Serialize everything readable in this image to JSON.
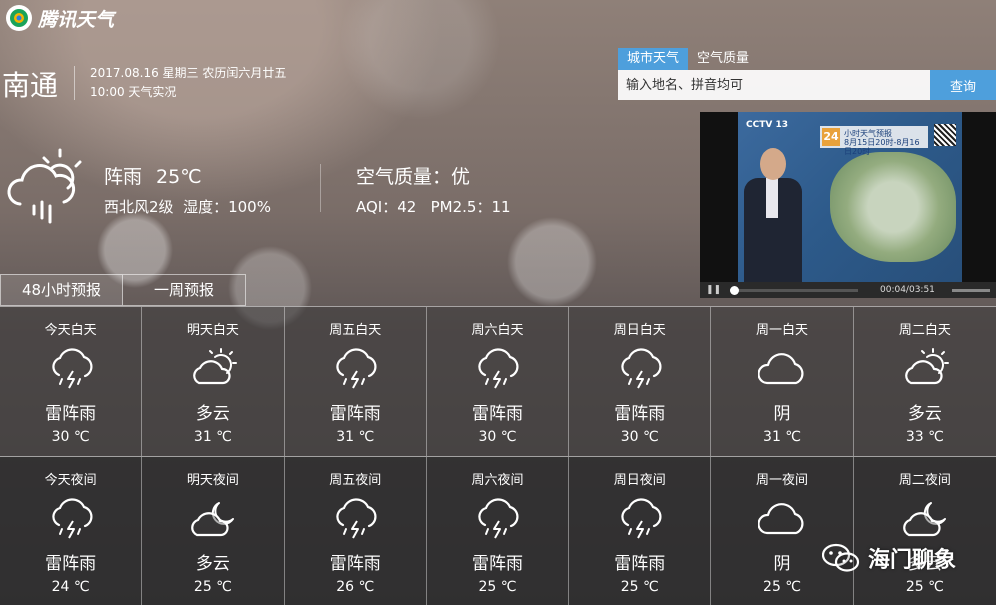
{
  "brand": {
    "name": "腾讯天气"
  },
  "location": {
    "city": "南通"
  },
  "observation": {
    "date_line": "2017.08.16 星期三 农历闰六月廿五",
    "time_line": "10:00 天气实况"
  },
  "search": {
    "tabs": [
      "城市天气",
      "空气质量"
    ],
    "active_tab": 0,
    "placeholder": "输入地名、拼音均可",
    "button": "查询"
  },
  "current": {
    "icon": "rain-cloud-sun-icon",
    "condition": "阵雨",
    "temperature": "25℃",
    "wind": "西北风2级",
    "humidity": "湿度：100%"
  },
  "air": {
    "title": "空气质量：优",
    "aqi_line": "AQI：42   PM2.5：11"
  },
  "video": {
    "logo": "CCTV 13",
    "banner_num": "24",
    "banner_title": "小时天气预报",
    "banner_sub": "8月15日20时-8月16日20时",
    "time": "00:04/03:51"
  },
  "forecast_tabs": [
    "48小时预报",
    "一周预报"
  ],
  "active_forecast_tab": 0,
  "day_forecast": [
    {
      "label": "今天白天",
      "icon": "thunder-rain-icon",
      "condition": "雷阵雨",
      "temp": "30 ℃"
    },
    {
      "label": "明天白天",
      "icon": "cloudy-sun-icon",
      "condition": "多云",
      "temp": "31 ℃"
    },
    {
      "label": "周五白天",
      "icon": "thunder-rain-icon",
      "condition": "雷阵雨",
      "temp": "31 ℃"
    },
    {
      "label": "周六白天",
      "icon": "thunder-rain-icon",
      "condition": "雷阵雨",
      "temp": "30 ℃"
    },
    {
      "label": "周日白天",
      "icon": "thunder-rain-icon",
      "condition": "雷阵雨",
      "temp": "30 ℃"
    },
    {
      "label": "周一白天",
      "icon": "overcast-icon",
      "condition": "阴",
      "temp": "31 ℃"
    },
    {
      "label": "周二白天",
      "icon": "cloudy-sun-icon",
      "condition": "多云",
      "temp": "33 ℃"
    }
  ],
  "night_forecast": [
    {
      "label": "今天夜间",
      "icon": "thunder-rain-icon",
      "condition": "雷阵雨",
      "temp": "24 ℃"
    },
    {
      "label": "明天夜间",
      "icon": "cloudy-moon-icon",
      "condition": "多云",
      "temp": "25 ℃"
    },
    {
      "label": "周五夜间",
      "icon": "thunder-rain-icon",
      "condition": "雷阵雨",
      "temp": "26 ℃"
    },
    {
      "label": "周六夜间",
      "icon": "thunder-rain-icon",
      "condition": "雷阵雨",
      "temp": "25 ℃"
    },
    {
      "label": "周日夜间",
      "icon": "thunder-rain-icon",
      "condition": "雷阵雨",
      "temp": "25 ℃"
    },
    {
      "label": "周一夜间",
      "icon": "overcast-icon",
      "condition": "阴",
      "temp": "25 ℃"
    },
    {
      "label": "周二夜间",
      "icon": "cloudy-moon-icon",
      "condition": "多云",
      "temp": "25 ℃"
    }
  ],
  "watermark": {
    "icon": "wechat-icon",
    "text": "海门聊象"
  },
  "colors": {
    "accent": "#4e9fdc"
  }
}
